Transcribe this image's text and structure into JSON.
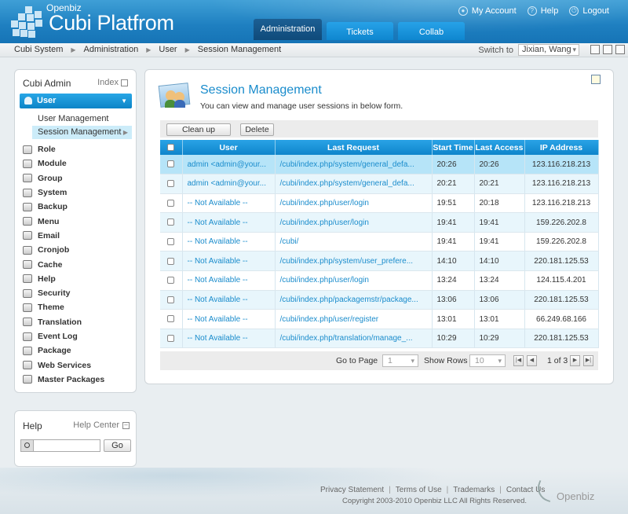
{
  "header": {
    "brand_small": "Openbiz",
    "brand": "Cubi Platfrom",
    "links": [
      "My Account",
      "Help",
      "Logout"
    ],
    "tabs": [
      "Administration",
      "Tickets",
      "Collab"
    ]
  },
  "breadcrumb": [
    "Cubi System",
    "Administration",
    "User",
    "Session Management"
  ],
  "switch_to": {
    "label": "Switch to",
    "value": "Jixian, Wang"
  },
  "sidebar": {
    "title": "Cubi Admin",
    "index_label": "Index",
    "active_menu": "User",
    "submenu": [
      "User Management",
      "Session Management"
    ],
    "menu": [
      "Role",
      "Module",
      "Group",
      "System",
      "Backup",
      "Menu",
      "Email",
      "Cronjob",
      "Cache",
      "Help",
      "Security",
      "Theme",
      "Translation",
      "Event Log",
      "Package",
      "Web Services",
      "Master Packages"
    ]
  },
  "help": {
    "title": "Help",
    "center": "Help Center",
    "go": "Go"
  },
  "main": {
    "title": "Session Management",
    "description": "You can view and manage user sessions in below form.",
    "buttons": {
      "cleanup": "Clean up",
      "delete": "Delete"
    },
    "columns": [
      "User",
      "Last Request",
      "Start Time",
      "Last Access",
      "IP Address"
    ],
    "rows": [
      [
        "admin <admin@your...",
        "/cubi/index.php/system/general_defa...",
        "20:26",
        "20:26",
        "123.116.218.213"
      ],
      [
        "admin <admin@your...",
        "/cubi/index.php/system/general_defa...",
        "20:21",
        "20:21",
        "123.116.218.213"
      ],
      [
        "-- Not Available --",
        "/cubi/index.php/user/login",
        "19:51",
        "20:18",
        "123.116.218.213"
      ],
      [
        "-- Not Available --",
        "/cubi/index.php/user/login",
        "19:41",
        "19:41",
        "159.226.202.8"
      ],
      [
        "-- Not Available --",
        "/cubi/",
        "19:41",
        "19:41",
        "159.226.202.8"
      ],
      [
        "-- Not Available --",
        "/cubi/index.php/system/user_prefere...",
        "14:10",
        "14:10",
        "220.181.125.53"
      ],
      [
        "-- Not Available --",
        "/cubi/index.php/user/login",
        "13:24",
        "13:24",
        "124.115.4.201"
      ],
      [
        "-- Not Available --",
        "/cubi/index.php/packagemstr/package...",
        "13:06",
        "13:06",
        "220.181.125.53"
      ],
      [
        "-- Not Available --",
        "/cubi/index.php/user/register",
        "13:01",
        "13:01",
        "66.249.68.166"
      ],
      [
        "-- Not Available --",
        "/cubi/index.php/translation/manage_...",
        "10:29",
        "10:29",
        "220.181.125.53"
      ]
    ],
    "pager": {
      "go_to_page": "Go to Page",
      "page": "1",
      "show_rows": "Show Rows",
      "rows": "10",
      "page_info": "1 of 3"
    }
  },
  "footer": {
    "links": [
      "Privacy Statement",
      "Terms of Use",
      "Trademarks",
      "Contact Us"
    ],
    "copyright": "Copyright 2003-2010 Openbiz LLC All Rights Reserved.",
    "brand": "Openbiz"
  }
}
